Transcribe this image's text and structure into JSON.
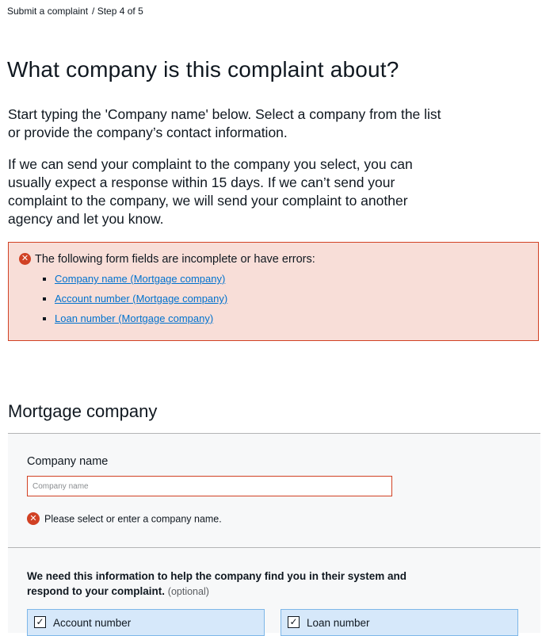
{
  "breadcrumb": {
    "link": "Submit a complaint",
    "step": "/ Step 4 of 5"
  },
  "page": {
    "title": "What company is this complaint about?",
    "intro_1": "Start typing the 'Company name' below. Select a company from the list or provide the company’s contact information.",
    "intro_2": "If we can send your complaint to the company you select, you can usually expect a response within 15 days. If we can’t send your complaint to the company, we will send your complaint to another agency and let you know."
  },
  "error_summary": {
    "heading": "The following form fields are incomplete or have errors:",
    "items": [
      "Company name (Mortgage company)",
      "Account number (Mortgage company)",
      "Loan number (Mortgage company)"
    ],
    "color": "#d14124"
  },
  "section": {
    "title": "Mortgage company",
    "company_label": "Company name",
    "company_placeholder": "Company name",
    "company_value": "",
    "company_error": "Please select or enter a company name.",
    "info_text": "We need this information to help the company find you in their system and respond to your complaint.",
    "optional_text": "(optional)",
    "checkboxes": [
      {
        "label": "Account number",
        "checked": true
      },
      {
        "label": "Loan number",
        "checked": true
      }
    ]
  },
  "icons": {
    "error": "error-circle-icon",
    "check": "checkmark-icon"
  }
}
